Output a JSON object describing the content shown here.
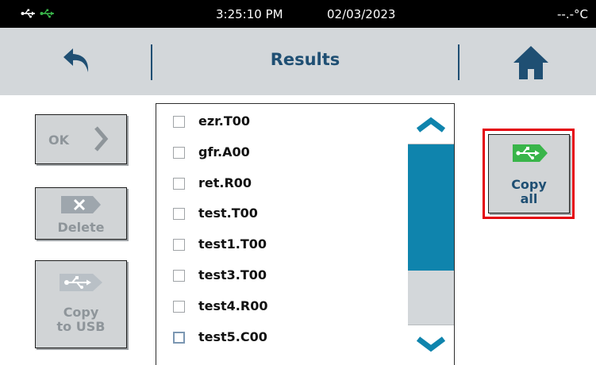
{
  "status_bar": {
    "time": "3:25:10 PM",
    "date": "02/03/2023",
    "temperature": "--.-°C"
  },
  "header": {
    "title": "Results"
  },
  "buttons": {
    "ok_label": "OK",
    "delete_label": "Delete",
    "copy_to_usb_line1": "Copy",
    "copy_to_usb_line2": "to USB",
    "copy_all_line1": "Copy",
    "copy_all_line2": "all"
  },
  "files": [
    {
      "name": "ezr.T00",
      "selected": false
    },
    {
      "name": "gfr.A00",
      "selected": false
    },
    {
      "name": "ret.R00",
      "selected": false
    },
    {
      "name": "test.T00",
      "selected": false
    },
    {
      "name": "test1.T00",
      "selected": false
    },
    {
      "name": "test3.T00",
      "selected": false
    },
    {
      "name": "test4.R00",
      "selected": false
    },
    {
      "name": "test5.C00",
      "selected": true
    }
  ],
  "colors": {
    "accent": "#1f4f73",
    "scroll_thumb": "#0f84ad",
    "usb_green": "#39b54a",
    "highlight_red": "#e4000b"
  }
}
